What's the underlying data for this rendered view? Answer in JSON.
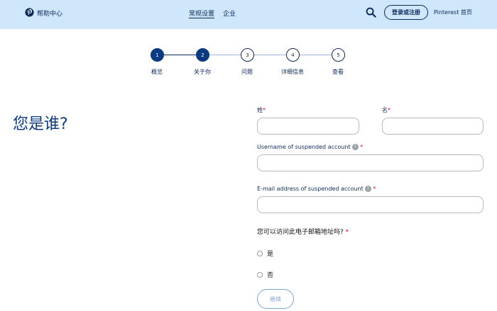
{
  "header": {
    "brand": "帮助中心",
    "nav": [
      {
        "label": "常规设置",
        "active": true
      },
      {
        "label": "企业",
        "active": false
      }
    ],
    "login_label": "登录或注册",
    "home_label": "Pinterest 首页"
  },
  "steps": [
    {
      "number": "1",
      "label": "概览",
      "state": "done"
    },
    {
      "number": "2",
      "label": "关于你",
      "state": "done"
    },
    {
      "number": "3",
      "label": "问题",
      "state": "todo"
    },
    {
      "number": "4",
      "label": "详细信息",
      "state": "todo"
    },
    {
      "number": "5",
      "label": "查看",
      "state": "todo"
    }
  ],
  "page_title": "您是谁?",
  "form": {
    "last_name_label": "姓",
    "first_name_label": "名",
    "username_label": "Username of suspended account",
    "email_label": "E-mail address of suspended account",
    "help_glyph": "?",
    "required_mark": "*",
    "email_access_question": "您可以访问此电子邮箱地址吗?",
    "options": [
      "是",
      "否"
    ],
    "continue_label": "继续"
  },
  "colors": {
    "header_bg": "#cfe6fb",
    "primary": "#0b3a82",
    "required": "#e60023"
  }
}
